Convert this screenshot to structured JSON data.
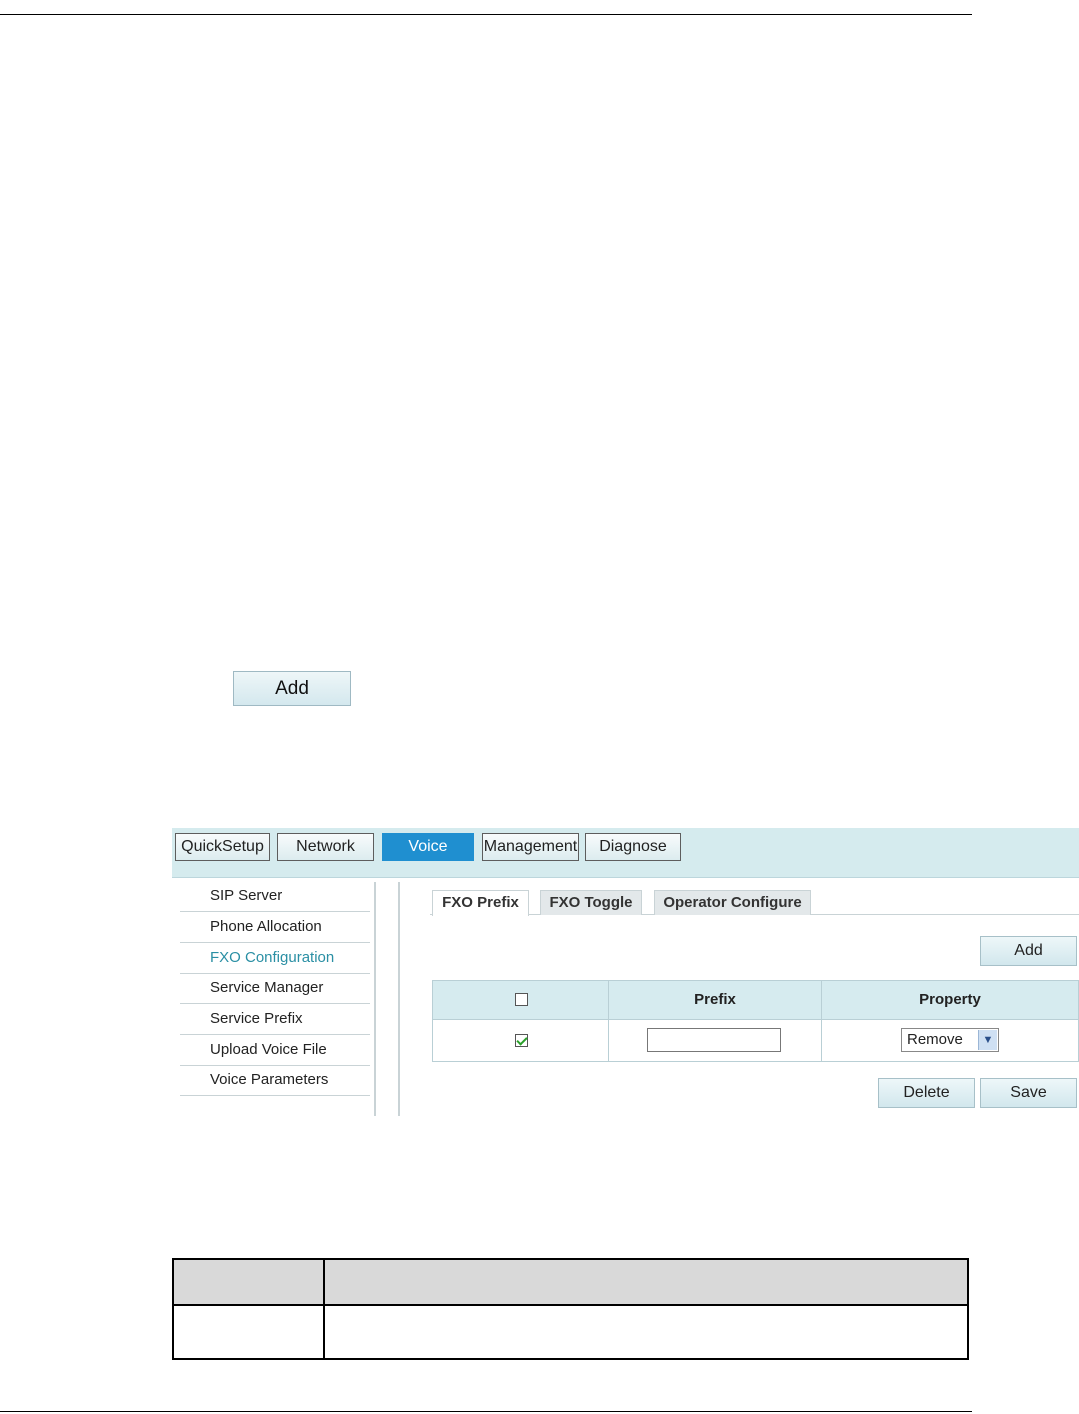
{
  "document": {
    "add_button_label": "Add"
  },
  "app": {
    "top_nav": [
      {
        "label": "QuickSetup",
        "active": false
      },
      {
        "label": "Network",
        "active": false
      },
      {
        "label": "Voice",
        "active": true
      },
      {
        "label": "Management",
        "active": false
      },
      {
        "label": "Diagnose",
        "active": false
      }
    ],
    "sidebar": [
      {
        "label": "SIP Server",
        "active": false
      },
      {
        "label": "Phone Allocation",
        "active": false
      },
      {
        "label": "FXO Configuration",
        "active": true
      },
      {
        "label": "Service Manager",
        "active": false
      },
      {
        "label": "Service Prefix",
        "active": false
      },
      {
        "label": "Upload Voice File",
        "active": false
      },
      {
        "label": "Voice Parameters",
        "active": false
      }
    ],
    "tabs": [
      {
        "label": "FXO Prefix",
        "active": true
      },
      {
        "label": "FXO Toggle",
        "active": false
      },
      {
        "label": "Operator Configure",
        "active": false
      }
    ],
    "add_label": "Add",
    "table": {
      "headers": [
        "",
        "Prefix",
        "Property"
      ],
      "header_checkbox_checked": false,
      "row": {
        "checked": true,
        "prefix_value": "",
        "property_value": "Remove"
      }
    },
    "delete_label": "Delete",
    "save_label": "Save"
  },
  "desc_table": {
    "headers": [
      "",
      ""
    ],
    "rows": [
      [
        "",
        ""
      ]
    ]
  },
  "colors": {
    "accent": "#1f8fd0",
    "active_side": "#2a8fa4",
    "topbar": "#d5ebee"
  }
}
